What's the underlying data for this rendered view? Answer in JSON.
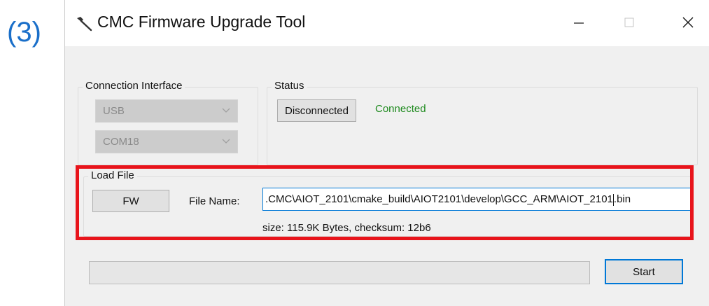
{
  "step_label": "(3)",
  "window": {
    "title": "CMC Firmware Upgrade Tool",
    "icon": "tool-icon",
    "controls": {
      "minimize": "—",
      "maximize": "☐",
      "close": "✕"
    }
  },
  "connection": {
    "legend": "Connection Interface",
    "interface_value": "USB",
    "port_value": "COM18"
  },
  "status": {
    "legend": "Status",
    "button_label": "Disconnected",
    "state_text": "Connected",
    "state_color": "#1e8a1e"
  },
  "load_file": {
    "legend": "Load File",
    "fw_button": "FW",
    "file_name_label": "File Name:",
    "file_name_visible_prefix": ".CMC\\AIOT_2101\\cmake_build\\AIOT2101\\develop\\GCC_ARM\\AIOT_2101",
    "file_name_visible_suffix": ".bin",
    "info": "size: 115.9K Bytes, checksum: 12b6"
  },
  "progress": {
    "value": 0
  },
  "start_button": "Start",
  "highlight_color": "#e8141b"
}
